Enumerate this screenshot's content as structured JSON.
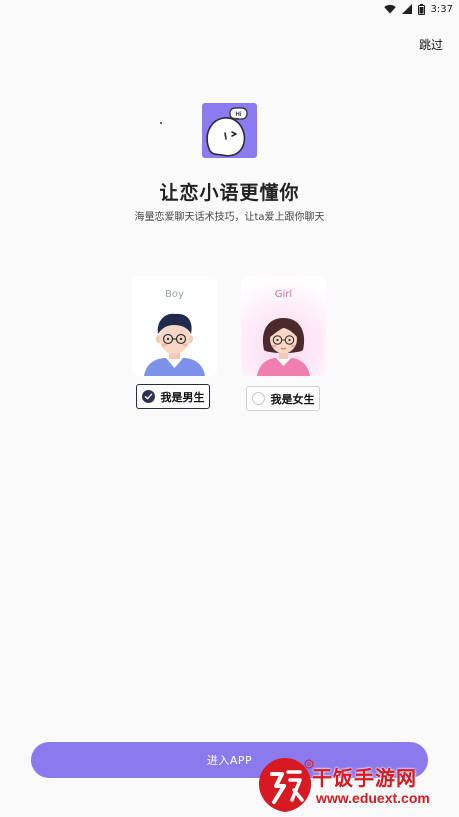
{
  "status_bar": {
    "time": "3:37",
    "icons": [
      "wifi-icon",
      "signal-icon",
      "battery-icon"
    ]
  },
  "header": {
    "skip_label": "跳过"
  },
  "app": {
    "logo_bubble_text": "Hi",
    "title": "让恋小语更懂你",
    "subtitle": "海量恋爱聊天话术技巧，让ta爱上跟你聊天"
  },
  "gender": {
    "options": [
      {
        "card_label": "Boy",
        "choice_label": "我是男生",
        "selected": true
      },
      {
        "card_label": "Girl",
        "choice_label": "我是女生",
        "selected": false
      }
    ]
  },
  "footer": {
    "enter_label": "进入APP"
  },
  "watermark": {
    "title": "干饭手游网",
    "url": "www.eduext.com"
  },
  "colors": {
    "accent": "#8b79ee",
    "logo_bg": "#8a7bf0",
    "selected_radio": "#2f3150",
    "watermark_red": "#d71921"
  }
}
